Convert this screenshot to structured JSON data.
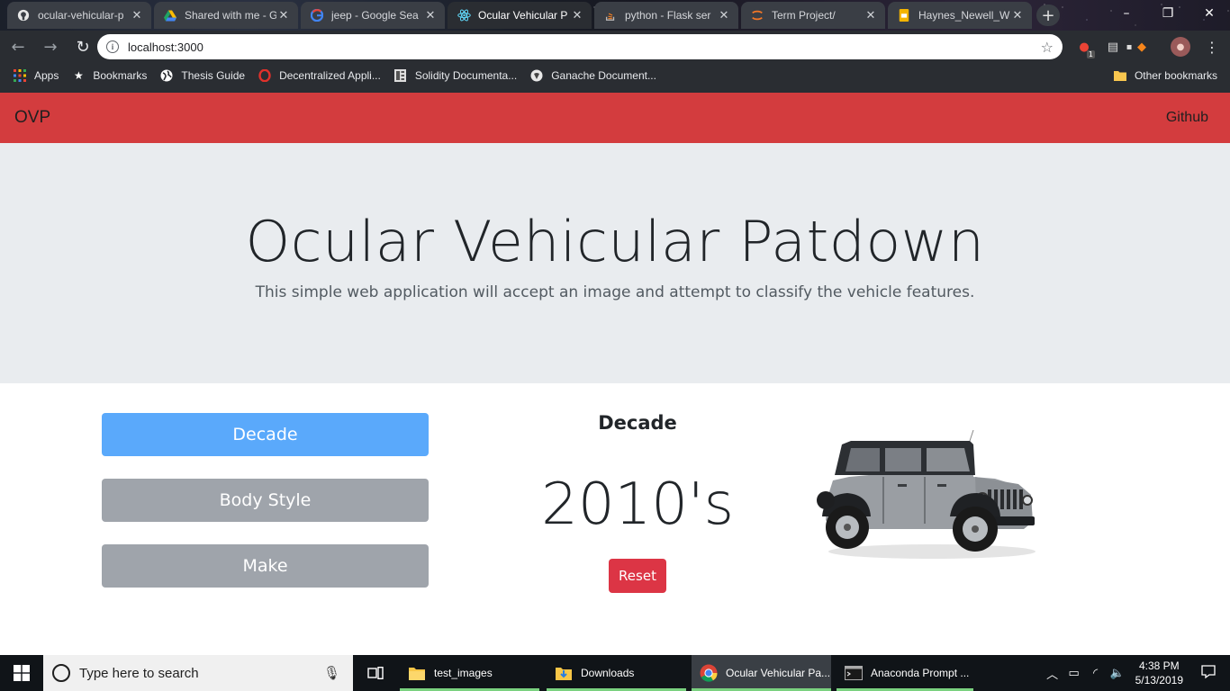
{
  "browser": {
    "tabs": [
      {
        "title": "ocular-vehicular-p",
        "icon": "github-icon",
        "active": false
      },
      {
        "title": "Shared with me - G",
        "icon": "google-drive-icon",
        "active": false
      },
      {
        "title": "jeep - Google Sea",
        "icon": "google-icon",
        "active": false
      },
      {
        "title": "Ocular Vehicular P",
        "icon": "react-icon",
        "active": true
      },
      {
        "title": "python - Flask ser",
        "icon": "stackoverflow-icon",
        "active": false
      },
      {
        "title": "Term Project/",
        "icon": "jupyter-icon",
        "active": false
      },
      {
        "title": "Haynes_Newell_W",
        "icon": "slides-icon",
        "active": false
      }
    ],
    "url": "localhost:3000",
    "bookmarks": [
      {
        "label": "Apps",
        "icon": "apps-grid-icon"
      },
      {
        "label": "Bookmarks",
        "icon": "star-icon"
      },
      {
        "label": "Thesis Guide",
        "icon": "globe-icon"
      },
      {
        "label": "Decentralized Appli...",
        "icon": "opera-icon"
      },
      {
        "label": "Solidity Documenta...",
        "icon": "document-icon"
      },
      {
        "label": "Ganache Document...",
        "icon": "ganache-icon"
      }
    ],
    "other_bookmarks": "Other bookmarks",
    "extension_badge": "1"
  },
  "app": {
    "brand": "OVP",
    "nav_link": "Github",
    "title": "Ocular Vehicular Patdown",
    "lead": "This simple web application will accept an image and attempt to classify the vehicle features.",
    "options": [
      {
        "label": "Decade",
        "state": "selected"
      },
      {
        "label": "Body Style",
        "state": "unselected"
      },
      {
        "label": "Make",
        "state": "unselected"
      }
    ],
    "result": {
      "heading": "Decade",
      "value": "2010's"
    },
    "reset_label": "Reset",
    "colors": {
      "navbar": "#d33c3e",
      "jumbotron": "#e9ecef",
      "primary": "#5aa9fb",
      "secondary": "#9fa4ab",
      "danger": "#dc3545"
    }
  },
  "taskbar": {
    "search_placeholder": "Type here to search",
    "items": [
      {
        "label": "test_images",
        "icon": "folder-icon",
        "active": false
      },
      {
        "label": "Downloads",
        "icon": "folder-download-icon",
        "active": false
      },
      {
        "label": "Ocular Vehicular Pa...",
        "icon": "chrome-icon",
        "active": true
      },
      {
        "label": "Anaconda Prompt ...",
        "icon": "terminal-icon",
        "active": false
      }
    ],
    "time": "4:38 PM",
    "date": "5/13/2019"
  }
}
